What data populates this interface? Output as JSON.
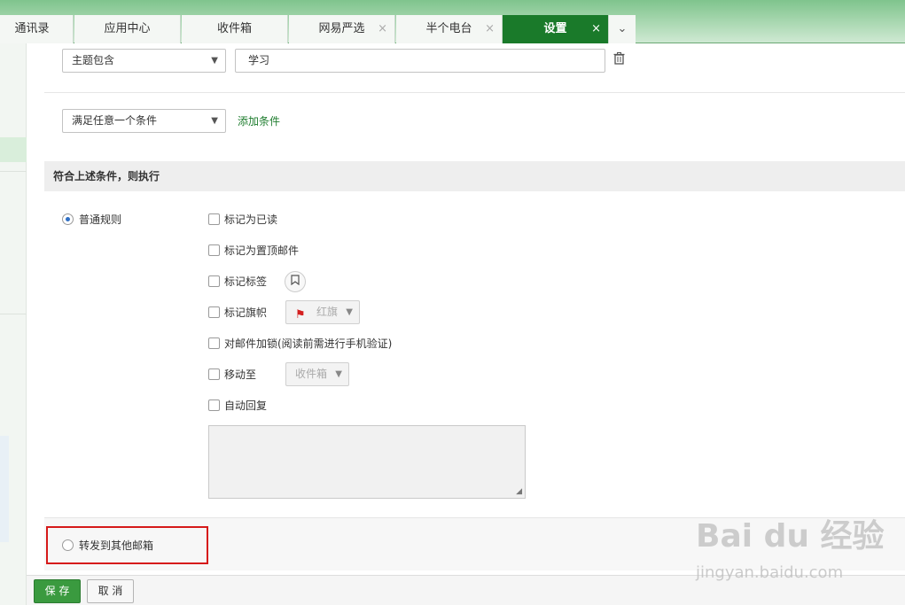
{
  "tabs": [
    {
      "label": "通讯录",
      "closable": false,
      "active": false
    },
    {
      "label": "应用中心",
      "closable": false,
      "active": false
    },
    {
      "label": "收件箱",
      "closable": false,
      "active": false
    },
    {
      "label": "网易严选",
      "closable": true,
      "active": false
    },
    {
      "label": "半个电台",
      "closable": true,
      "active": false
    },
    {
      "label": "设置",
      "closable": true,
      "active": true
    }
  ],
  "tab_close_glyph": "×",
  "tab_more_glyph": "⌄",
  "condition": {
    "field_select": "主题包含",
    "value": "学习",
    "match_select": "满足任意一个条件",
    "add_condition_link": "添加条件"
  },
  "action_section": {
    "title": "符合上述条件，则执行",
    "normal_rule_label": "普通规则",
    "actions": {
      "mark_read": "标记为已读",
      "mark_top": "标记为置顶邮件",
      "mark_tag": "标记标签",
      "mark_flag": "标记旗帜",
      "flag_select": "红旗",
      "lock": "对邮件加锁(阅读前需进行手机验证)",
      "move_to": "移动至",
      "move_select": "收件箱",
      "auto_reply": "自动回复"
    },
    "forward_label": "转发到其他邮箱"
  },
  "buttons": {
    "save": "保 存",
    "cancel": "取 消"
  },
  "watermark": {
    "line1": "Bai du 经验",
    "line2": "jingyan.baidu.com"
  },
  "colors": {
    "active_tab": "#1a7a2a",
    "link": "#1f7d2f",
    "save_button": "#3a9a3f",
    "highlight_box": "#d61a1a"
  }
}
